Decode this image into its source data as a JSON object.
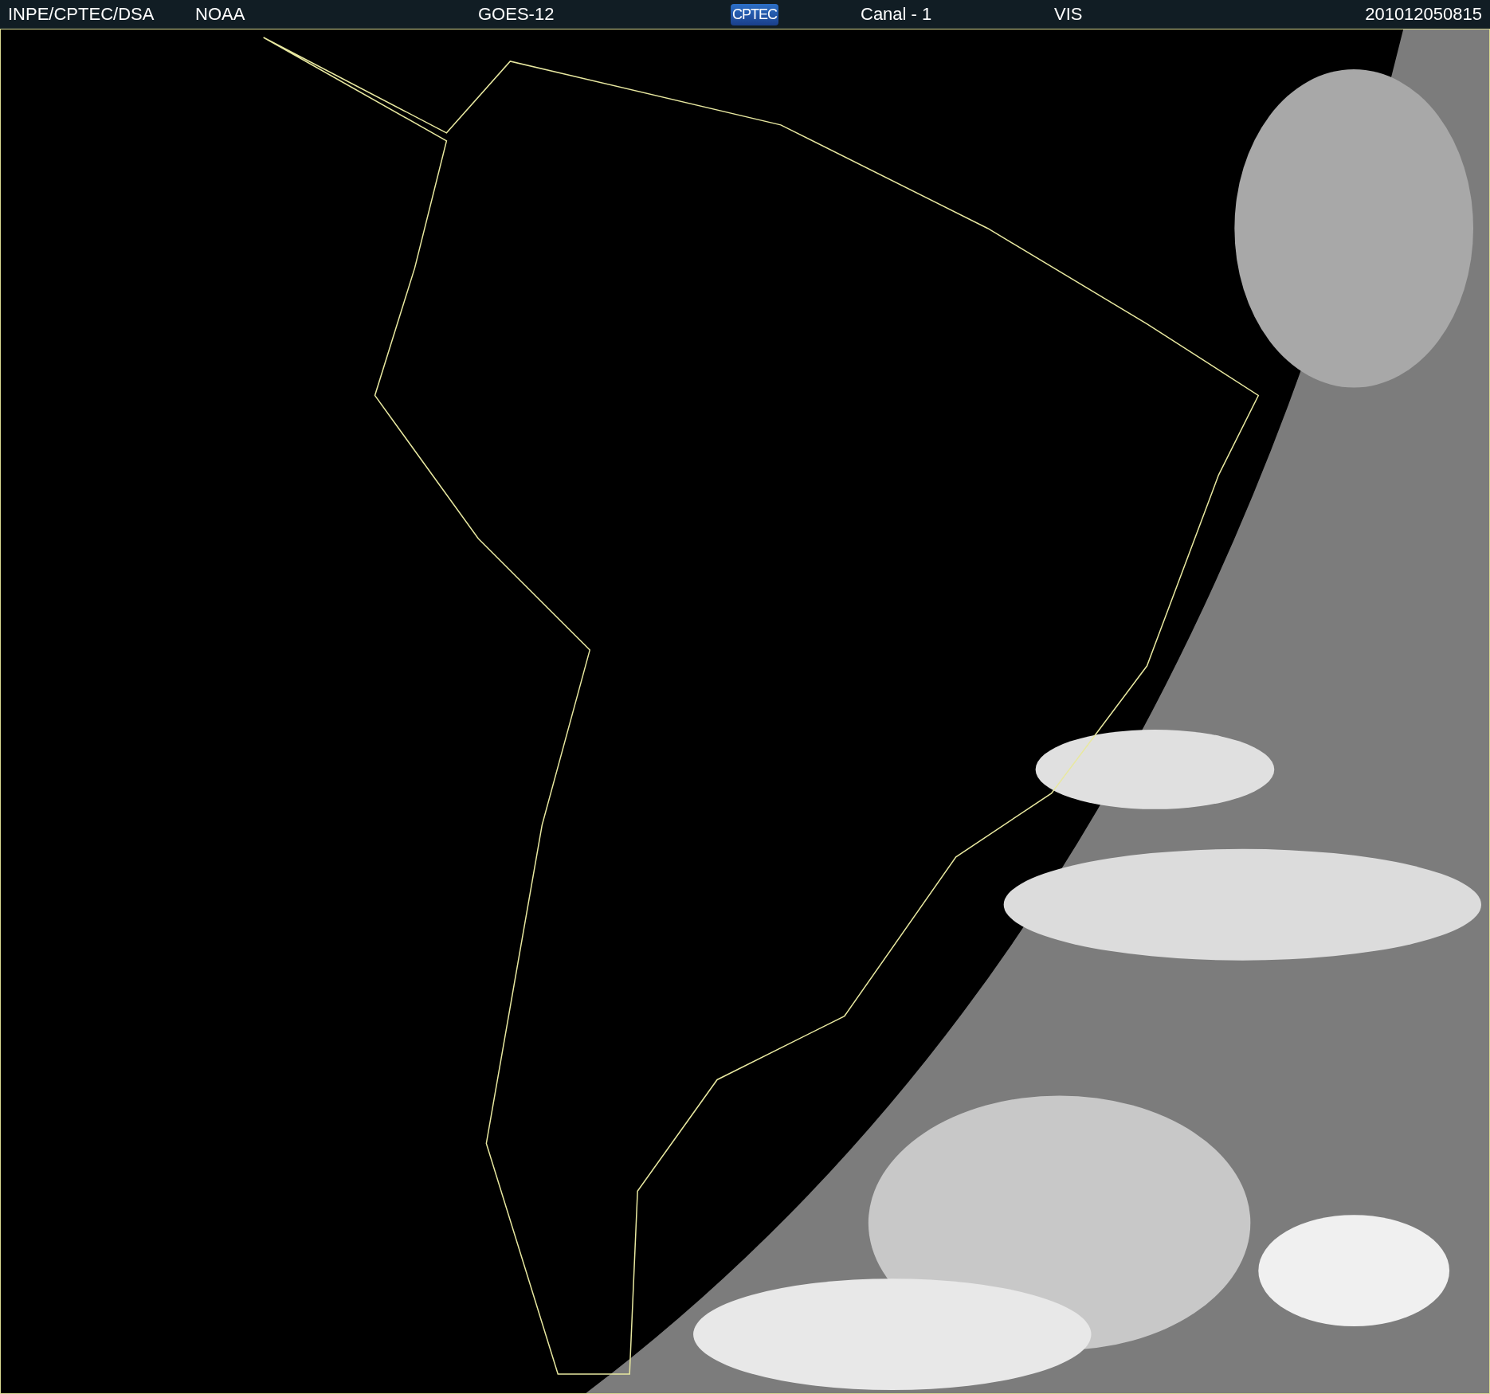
{
  "header": {
    "items": [
      {
        "kind": "text",
        "text": "INPE/CPTEC/DSA"
      },
      {
        "kind": "text",
        "text": "NOAA"
      },
      {
        "kind": "text",
        "text": "GOES-12"
      },
      {
        "kind": "logo",
        "text": "CPTEC"
      },
      {
        "kind": "text",
        "text": "Canal - 1"
      },
      {
        "kind": "text",
        "text": "VIS"
      },
      {
        "kind": "text",
        "text": "201012050815"
      }
    ]
  }
}
